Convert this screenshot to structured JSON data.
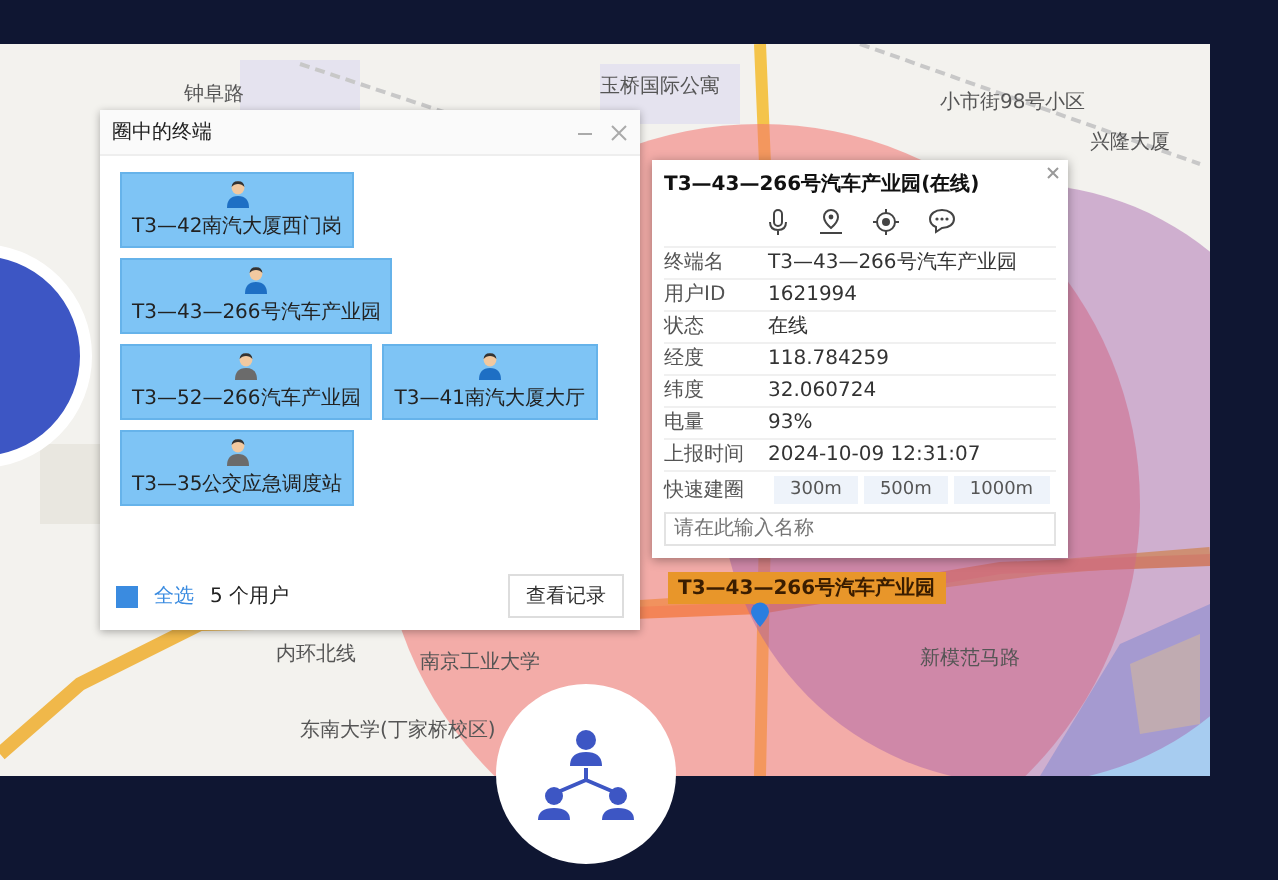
{
  "map": {
    "labels": [
      "钟阜路",
      "玉桥国际公寓",
      "兴隆大厦",
      "小市街98号小区",
      "内环北线",
      "南京工业大学",
      "东南大学(丁家桥校区)",
      "新模范马路"
    ],
    "marker_label": "T3—43—266号汽车产业园"
  },
  "dialog": {
    "title": "圈中的终端",
    "terminals": [
      {
        "name": "T3—42南汽大厦西门岗",
        "online": true
      },
      {
        "name": "T3—43—266号汽车产业园",
        "online": true
      },
      {
        "name": "T3—52—266汽车产业园",
        "online": false
      },
      {
        "name": "T3—41南汽大厦大厅",
        "online": true
      },
      {
        "name": "T3—35公交应急调度站",
        "online": false
      }
    ],
    "select_all": {
      "label": "全选",
      "checked": true
    },
    "count": "5 个用户",
    "button": "查看记录"
  },
  "popup": {
    "title": "T3—43—266号汽车产业园(在线)",
    "fields": [
      {
        "label": "终端名",
        "value": "T3—43—266号汽车产业园"
      },
      {
        "label": "用户ID",
        "value": "1621994"
      },
      {
        "label": "状态",
        "value": "在线"
      },
      {
        "label": "经度",
        "value": "118.784259"
      },
      {
        "label": "纬度",
        "value": "32.060724"
      },
      {
        "label": "电量",
        "value": "93%"
      },
      {
        "label": "上报时间",
        "value": "2024-10-09 12:31:07"
      }
    ],
    "quick_circle": {
      "label": "快速建圈",
      "options": [
        "300m",
        "500m",
        "1000m"
      ]
    },
    "name_input": {
      "placeholder": "请在此输入名称"
    }
  }
}
